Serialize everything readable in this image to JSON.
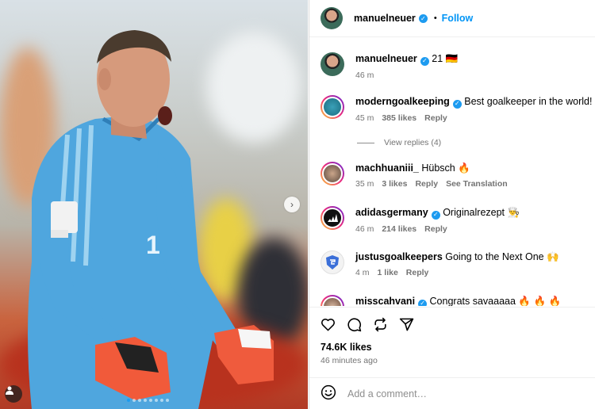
{
  "header": {
    "username": "manuelneuer",
    "separator": "•",
    "follow_label": "Follow"
  },
  "comments": [
    {
      "username": "manuelneuer",
      "text": "21 🇩🇪",
      "time": "46 m"
    },
    {
      "username": "moderngoalkeeping",
      "text": "Best goalkeeper in the world!",
      "time": "45 m",
      "likes": "385 likes",
      "reply": "Reply",
      "view_replies": "View replies (4)"
    },
    {
      "username": "machhuaniii_",
      "text": "Hübsch 🔥",
      "time": "35 m",
      "likes": "3 likes",
      "reply": "Reply",
      "translate": "See Translation"
    },
    {
      "username": "adidasgermany",
      "text": "Originalrezept 👨‍🍳",
      "time": "46 m",
      "likes": "214 likes",
      "reply": "Reply"
    },
    {
      "username": "justusgoalkeepers",
      "text": "Going to the Next One 🙌",
      "time": "4 m",
      "likes": "1 like",
      "reply": "Reply"
    },
    {
      "username": "misscahvani",
      "text": "Congrats savaaaaa 🔥 🔥 🔥"
    }
  ],
  "post": {
    "likes": "74.6K likes",
    "time_ago": "46 minutes ago",
    "comment_placeholder": "Add a comment…"
  },
  "colors": {
    "link": "#0095f6",
    "verified": "#1d9bf0",
    "secondary": "#737373",
    "jersey": "#4fa6de"
  },
  "icons": [
    "heart-icon",
    "comment-icon",
    "repost-icon",
    "share-icon",
    "emoji-icon",
    "chevron-right-icon",
    "user-tag-icon"
  ]
}
